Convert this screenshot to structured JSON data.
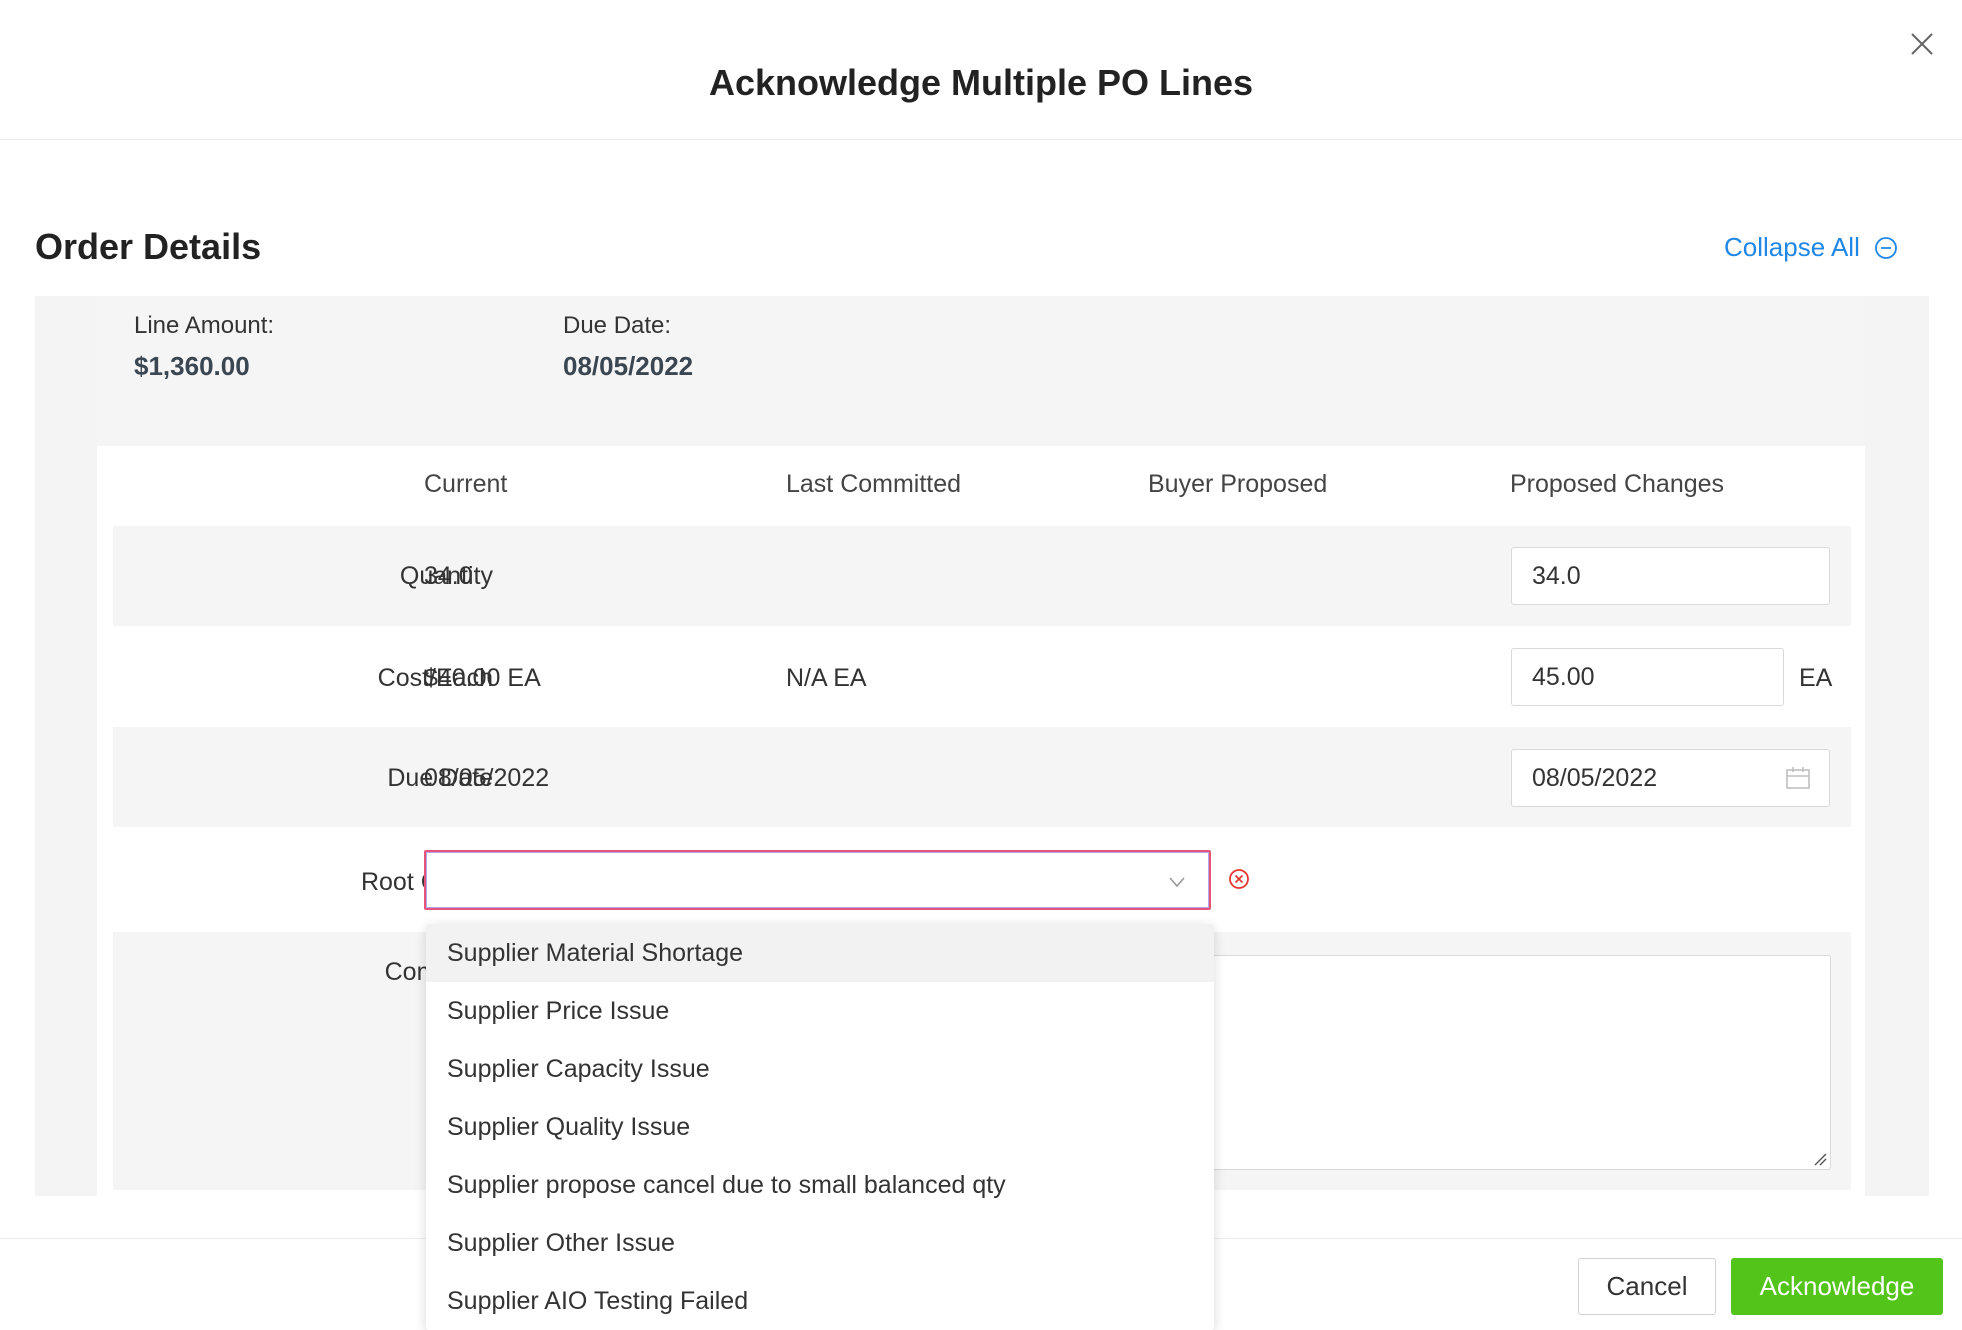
{
  "modal": {
    "title": "Acknowledge Multiple PO Lines"
  },
  "section": {
    "title": "Order Details",
    "collapse_label": "Collapse All"
  },
  "summary": {
    "line_amount_label": "Line Amount:",
    "line_amount_value": "$1,360.00",
    "due_date_label": "Due Date:",
    "due_date_value": "08/05/2022"
  },
  "columns": [
    "Current",
    "Last Committed",
    "Buyer Proposed",
    "Proposed Changes"
  ],
  "rows": {
    "quantity": {
      "label": "Quantity",
      "current": "34.0",
      "proposed": "34.0"
    },
    "cost": {
      "label": "Cost/Each",
      "current": "$40.00 EA",
      "last_committed": "N/A EA",
      "proposed": "45.00",
      "unit": "EA"
    },
    "due_date": {
      "label": "Due Date",
      "current": "08/05/2022",
      "proposed": "08/05/2022"
    },
    "root_cause": {
      "label": "Root Cause",
      "value": ""
    },
    "comment": {
      "label": "Comment"
    }
  },
  "root_cause_options": [
    "Supplier Material Shortage",
    "Supplier Price Issue",
    "Supplier Capacity Issue",
    "Supplier Quality Issue",
    "Supplier propose cancel due to small balanced qty",
    "Supplier Other Issue",
    "Supplier AIO Testing Failed"
  ],
  "footer": {
    "cancel_label": "Cancel",
    "acknowledge_label": "Acknowledge"
  },
  "colors": {
    "accent": "#1f87e5",
    "primary_button": "#52c41a",
    "error": "#e53935"
  },
  "icons": [
    "close-icon",
    "collapse-circle-icon",
    "calendar-icon",
    "chevron-down-icon",
    "error-circle-icon",
    "resize-handle-icon"
  ]
}
